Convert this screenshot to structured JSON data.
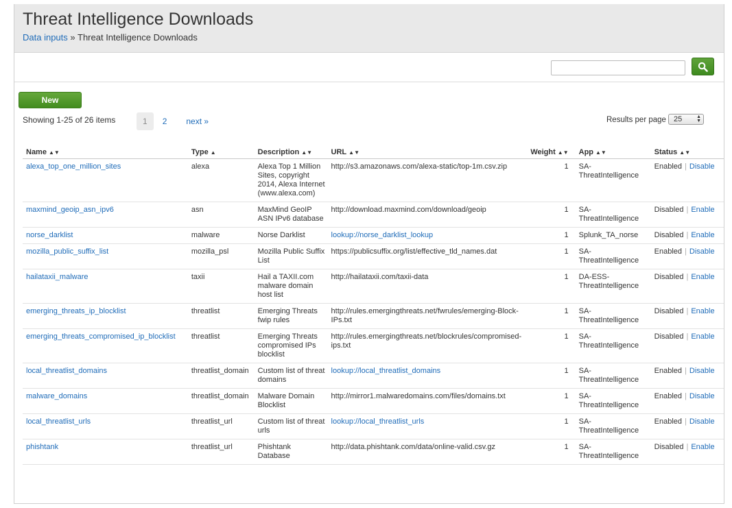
{
  "header": {
    "title": "Threat Intelligence Downloads",
    "breadcrumb_link": "Data inputs",
    "breadcrumb_sep": "»",
    "breadcrumb_current": "Threat Intelligence Downloads"
  },
  "search": {
    "value": "",
    "placeholder": "",
    "icon": "search-icon"
  },
  "toolbar": {
    "new_label": "New"
  },
  "pagination": {
    "showing": "Showing 1-25 of 26 items",
    "pages": [
      "1",
      "2"
    ],
    "current": "1",
    "next": "next »",
    "results_label": "Results per page",
    "results_value": "25"
  },
  "table": {
    "columns": [
      "Name",
      "Type",
      "Description",
      "URL",
      "Weight",
      "App",
      "Status"
    ],
    "sorted_column": "Type",
    "rows": [
      {
        "name": "alexa_top_one_million_sites",
        "type": "alexa",
        "description": "Alexa Top 1 Million Sites, copyright 2014, Alexa Internet (www.alexa.com)",
        "url": "http://s3.amazonaws.com/alexa-static/top-1m.csv.zip",
        "url_is_link": false,
        "weight": "1",
        "app": "SA-ThreatIntelligence",
        "status": "Enabled",
        "action": "Disable"
      },
      {
        "name": "maxmind_geoip_asn_ipv6",
        "type": "asn",
        "description": "MaxMind GeoIP ASN IPv6 database",
        "url": "http://download.maxmind.com/download/geoip",
        "url_is_link": false,
        "weight": "1",
        "app": "SA-ThreatIntelligence",
        "status": "Disabled",
        "action": "Enable"
      },
      {
        "name": "norse_darklist",
        "type": "malware",
        "description": "Norse Darklist",
        "url": "lookup://norse_darklist_lookup",
        "url_is_link": true,
        "weight": "1",
        "app": "Splunk_TA_norse",
        "status": "Disabled",
        "action": "Enable"
      },
      {
        "name": "mozilla_public_suffix_list",
        "type": "mozilla_psl",
        "description": "Mozilla Public Suffix List",
        "url": "https://publicsuffix.org/list/effective_tld_names.dat",
        "url_is_link": false,
        "weight": "1",
        "app": "SA-ThreatIntelligence",
        "status": "Enabled",
        "action": "Disable"
      },
      {
        "name": "hailataxii_malware",
        "type": "taxii",
        "description": "Hail a TAXII.com malware domain host list",
        "url": "http://hailataxii.com/taxii-data",
        "url_is_link": false,
        "weight": "1",
        "app": "DA-ESS-ThreatIntelligence",
        "status": "Disabled",
        "action": "Enable"
      },
      {
        "name": "emerging_threats_ip_blocklist",
        "type": "threatlist",
        "description": "Emerging Threats fwip rules",
        "url": "http://rules.emergingthreats.net/fwrules/emerging-Block-IPs.txt",
        "url_is_link": false,
        "weight": "1",
        "app": "SA-ThreatIntelligence",
        "status": "Disabled",
        "action": "Enable"
      },
      {
        "name": "emerging_threats_compromised_ip_blocklist",
        "type": "threatlist",
        "description": "Emerging Threats compromised IPs blocklist",
        "url": "http://rules.emergingthreats.net/blockrules/compromised-ips.txt",
        "url_is_link": false,
        "weight": "1",
        "app": "SA-ThreatIntelligence",
        "status": "Disabled",
        "action": "Enable"
      },
      {
        "name": "local_threatlist_domains",
        "type": "threatlist_domain",
        "description": "Custom list of threat domains",
        "url": "lookup://local_threatlist_domains",
        "url_is_link": true,
        "weight": "1",
        "app": "SA-ThreatIntelligence",
        "status": "Enabled",
        "action": "Disable"
      },
      {
        "name": "malware_domains",
        "type": "threatlist_domain",
        "description": "Malware Domain Blocklist",
        "url": "http://mirror1.malwaredomains.com/files/domains.txt",
        "url_is_link": false,
        "weight": "1",
        "app": "SA-ThreatIntelligence",
        "status": "Enabled",
        "action": "Disable"
      },
      {
        "name": "local_threatlist_urls",
        "type": "threatlist_url",
        "description": "Custom list of threat urls",
        "url": "lookup://local_threatlist_urls",
        "url_is_link": true,
        "weight": "1",
        "app": "SA-ThreatIntelligence",
        "status": "Enabled",
        "action": "Disable"
      },
      {
        "name": "phishtank",
        "type": "threatlist_url",
        "description": "Phishtank Database",
        "url": "http://data.phishtank.com/data/online-valid.csv.gz",
        "url_is_link": false,
        "weight": "1",
        "app": "SA-ThreatIntelligence",
        "status": "Disabled",
        "action": "Enable"
      }
    ]
  }
}
